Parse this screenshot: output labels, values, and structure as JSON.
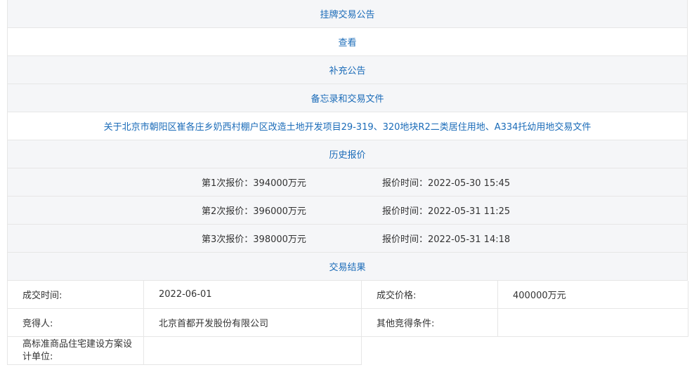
{
  "sections": {
    "listing_notice": "挂牌交易公告",
    "view_link": "查看",
    "supplement_notice": "补充公告",
    "memo_docs": "备忘录和交易文件",
    "doc_link": "关于北京市朝阳区崔各庄乡奶西村棚户区改造土地开发项目29-319、320地块R2二类居住用地、A334托幼用地交易文件",
    "bid_history": "历史报价",
    "result": "交易结果"
  },
  "bids": [
    {
      "amount": "第1次报价：394000万元",
      "time": "报价时间：2022-05-30 15:45"
    },
    {
      "amount": "第2次报价：396000万元",
      "time": "报价时间：2022-05-31 11:25"
    },
    {
      "amount": "第3次报价：398000万元",
      "time": "报价时间：2022-05-31 14:18"
    }
  ],
  "result_table": {
    "deal_time_label": "成交时间:",
    "deal_time": "2022-06-01",
    "deal_price_label": "成交价格:",
    "deal_price": "400000万元",
    "winner_label": "竞得人:",
    "winner": "北京首都开发股份有限公司",
    "other_conditions_label": "其他竞得条件:",
    "other_conditions": "",
    "designer_label": "高标准商品住宅建设方案设计单位:",
    "designer": ""
  },
  "colors": {
    "link": "#1a6bb8",
    "header_bg": "#f5f6f8",
    "border": "#e6e6e6"
  }
}
